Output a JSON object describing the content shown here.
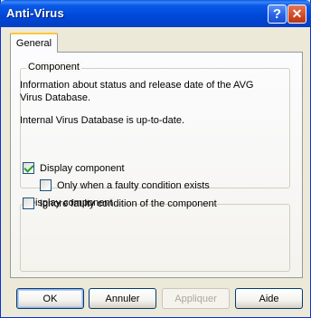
{
  "window": {
    "title": "Anti-Virus",
    "help_symbol": "?",
    "close_symbol": "✕"
  },
  "tabs": [
    {
      "label": "General",
      "selected": true
    }
  ],
  "component_group": {
    "legend": "Component",
    "description": "Information about status and release date of the AVG Virus Database.",
    "status": "Internal Virus Database is up-to-date."
  },
  "display_group": {
    "legend": "Display component",
    "options": [
      {
        "label": "Display component",
        "checked": true
      },
      {
        "label": "Only when a faulty condition exists",
        "checked": false
      },
      {
        "label": "Ignore faulty condition of the component",
        "checked": false
      }
    ]
  },
  "buttons": {
    "ok": "OK",
    "cancel": "Annuler",
    "apply": "Appliquer",
    "help": "Aide"
  },
  "colors": {
    "title_bar": "#0a5ae8",
    "close_button": "#d14a24",
    "tab_highlight": "#ffc83c",
    "checkmark": "#21a121"
  }
}
